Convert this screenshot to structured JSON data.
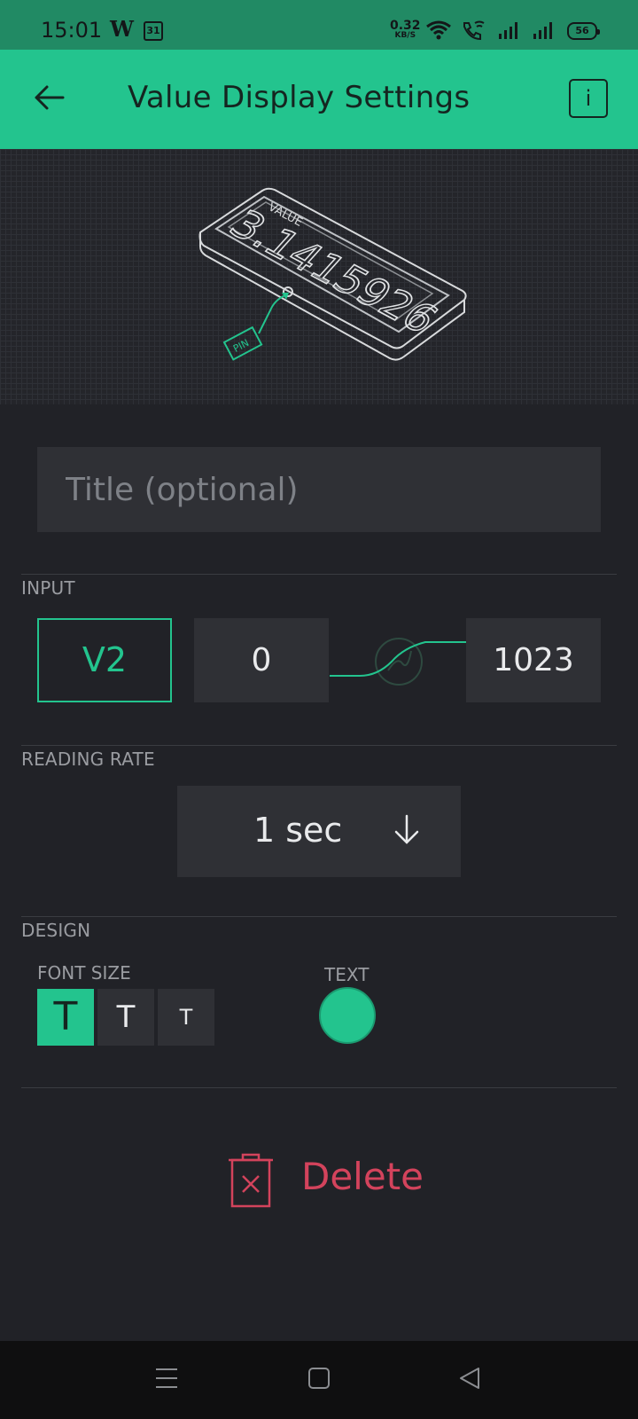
{
  "status_bar": {
    "time": "15:01",
    "app_icon_letter": "W",
    "calendar_day": "31",
    "net_speed_value": "0.32",
    "net_speed_unit": "KB/S",
    "battery": "56"
  },
  "app_bar": {
    "title": "Value Display Settings",
    "info_label": "i"
  },
  "hero": {
    "value_label": "VALUE",
    "value_number": "3.1415926",
    "pin_label": "PIN"
  },
  "title_field": {
    "placeholder": "Title (optional)",
    "value": ""
  },
  "input_section": {
    "label": "INPUT",
    "pin": "V2",
    "min": "0",
    "max": "1023"
  },
  "reading_rate": {
    "label": "READING RATE",
    "value": "1 sec"
  },
  "design": {
    "label": "DESIGN",
    "font_size_label": "FONT SIZE",
    "font_sizes": [
      "T",
      "T",
      "T"
    ],
    "text_label": "TEXT",
    "text_color": "#23c48e"
  },
  "delete": {
    "label": "Delete"
  },
  "colors": {
    "accent": "#23c48e",
    "background": "#212227",
    "field": "#2f3035",
    "danger": "#d3435c"
  }
}
